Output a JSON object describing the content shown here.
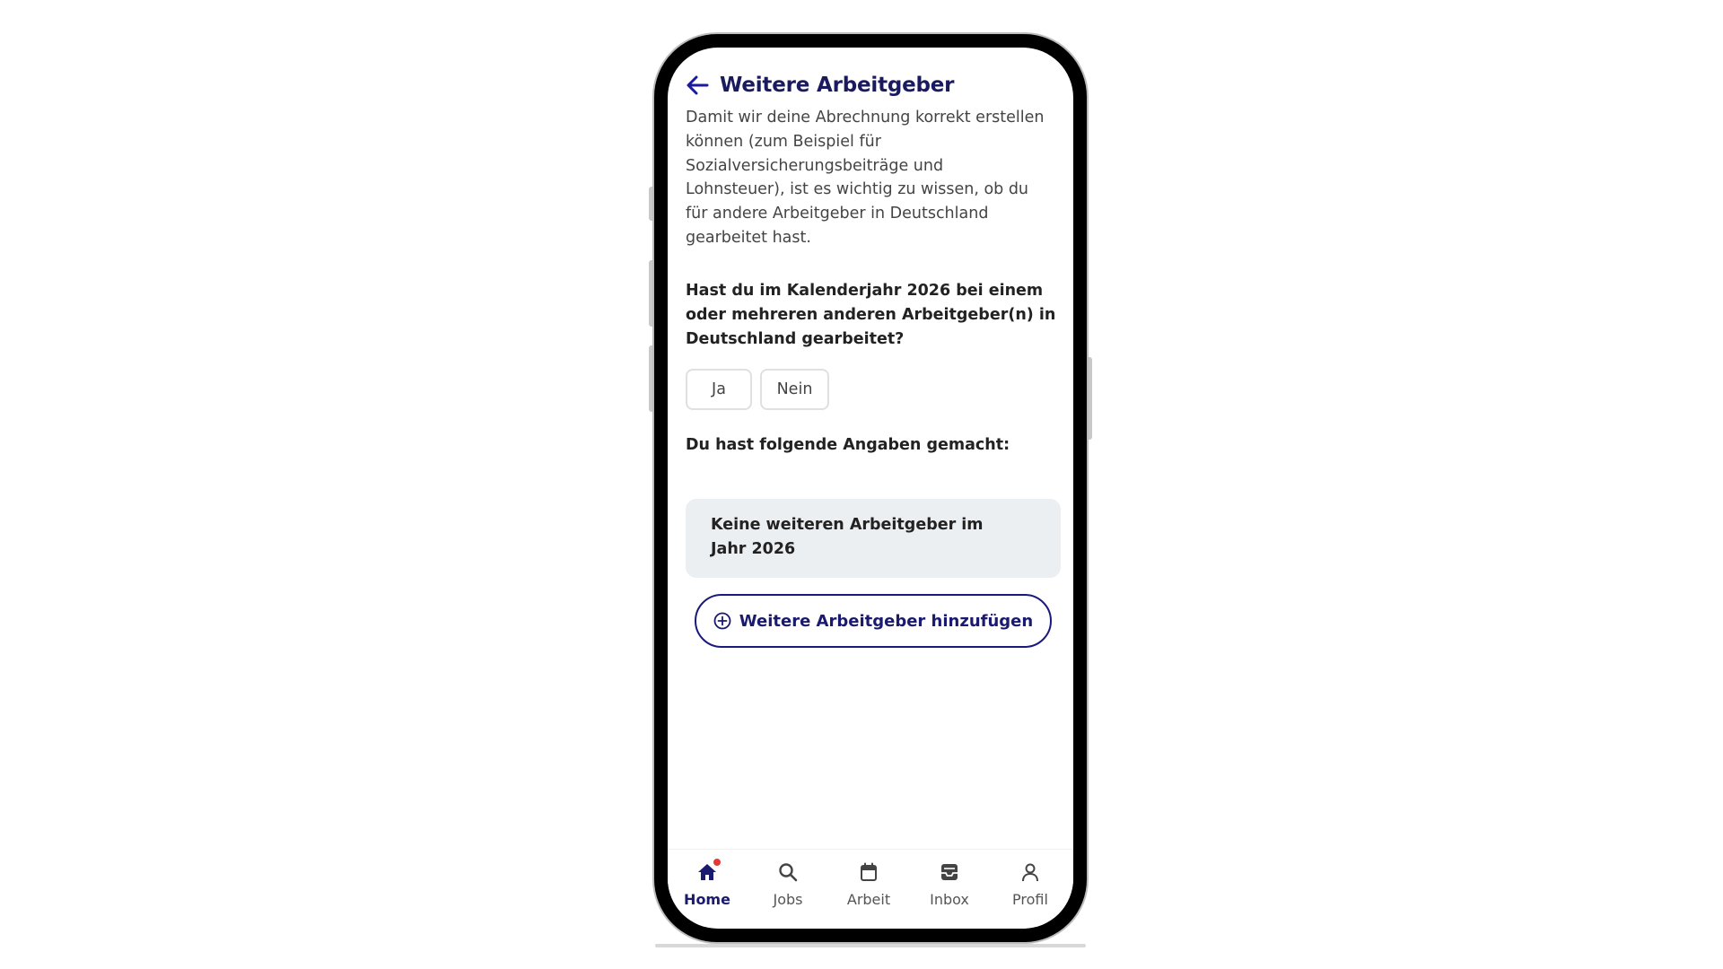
{
  "header": {
    "title": "Weitere Arbeitgeber"
  },
  "intro": {
    "text": "Damit wir deine Abrechnung korrekt erstellen können (zum Beispiel für Sozialversicherungsbeiträge und Lohnsteuer), ist es wichtig zu wissen, ob du für andere Arbeitgeber in Deutschland gearbeitet hast."
  },
  "question": {
    "text": "Hast du im Kalenderjahr 2026 bei einem oder mehreren anderen Arbeitgeber(n) in Deutschland gearbeitet?"
  },
  "choices": {
    "yes_label": "Ja",
    "no_label": "Nein"
  },
  "summary": {
    "label": "Du hast folgende Angaben gemacht:",
    "card_text": "Keine weiteren Arbeitgeber im Jahr 2026"
  },
  "add_button": {
    "label": "Weitere Arbeitgeber hinzufügen",
    "icon": "plus-circle-icon"
  },
  "bottom_nav": {
    "active": "Home",
    "items": [
      {
        "label": "Home",
        "icon": "home-icon",
        "has_badge": true
      },
      {
        "label": "Jobs",
        "icon": "search-icon"
      },
      {
        "label": "Arbeit",
        "icon": "calendar-icon"
      },
      {
        "label": "Inbox",
        "icon": "inbox-icon"
      },
      {
        "label": "Profil",
        "icon": "user-icon"
      }
    ]
  },
  "colors": {
    "brand_navy": "#1a1a6e",
    "badge_red": "#e53935",
    "card_bg": "#eceff1"
  }
}
